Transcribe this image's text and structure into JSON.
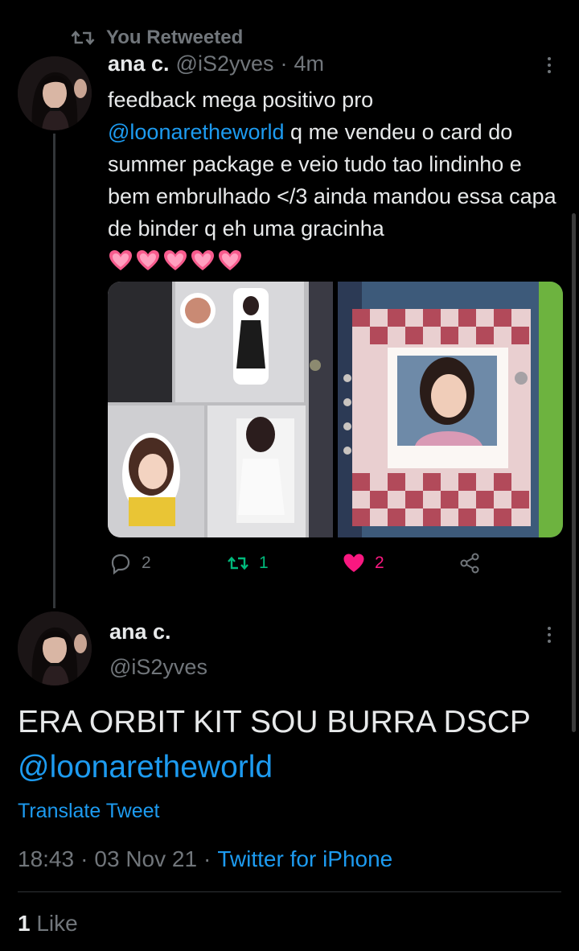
{
  "retweet_banner": {
    "label": "You Retweeted"
  },
  "tweet1": {
    "name": "ana c.",
    "handle": "@iS2yves",
    "dot": "·",
    "time": "4m",
    "text_before_mention": "feedback mega positivo pro",
    "mention": "@loonaretheworld",
    "text_after_mention": " q me vendeu o card do summer package e veio tudo tao lindinho e bem embrulhado </3 ainda mandou essa capa de binder q eh uma gracinha",
    "hearts_emoji": "💗💗💗💗💗",
    "actions": {
      "replies": "2",
      "retweets": "1",
      "likes": "2"
    },
    "colors": {
      "retweet_active": "#00ba7c",
      "like_active": "#f91880"
    }
  },
  "tweet2": {
    "name": "ana c.",
    "handle": "@iS2yves",
    "text": "ERA ORBIT KIT SOU BURRA DSCP",
    "mention": "@loonaretheworld",
    "translate": "Translate Tweet",
    "time": "18:43",
    "date": "03 Nov 21",
    "source": "Twitter for iPhone",
    "sep": "·",
    "like_count": "1",
    "like_label": "Like"
  },
  "colors": {
    "background": "#000000",
    "text": "#e7e9ea",
    "muted": "#71767b",
    "link": "#1d9bf0"
  }
}
